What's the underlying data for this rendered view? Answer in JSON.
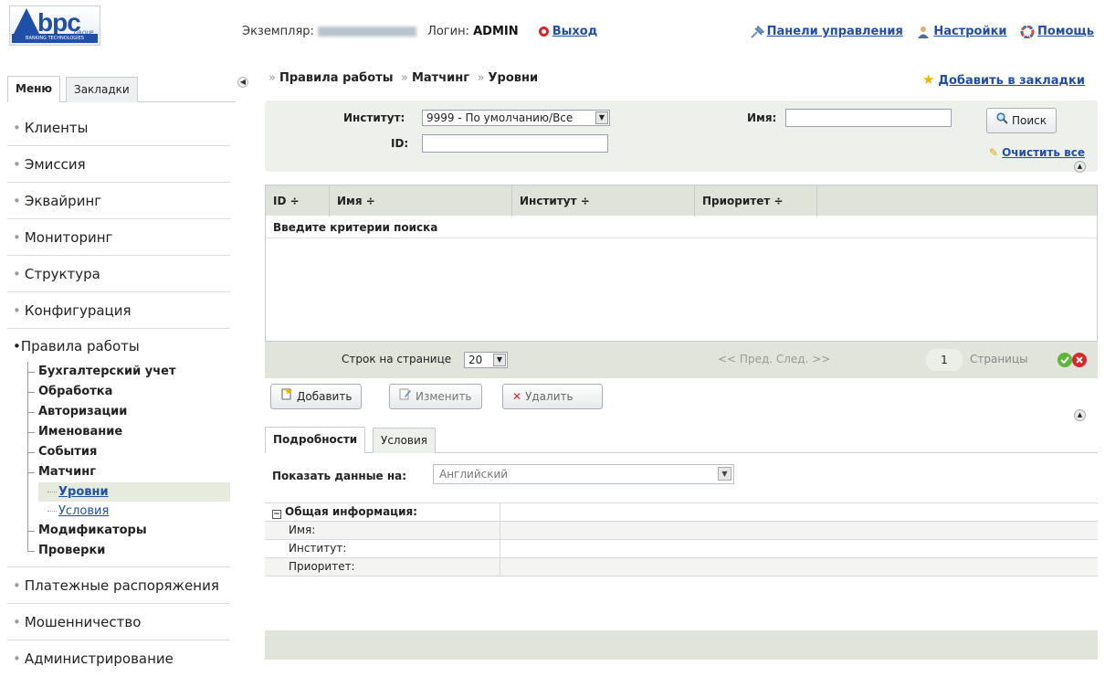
{
  "header": {
    "logo_text": "bpc",
    "logo_group": "GROUP",
    "logo_tagline": "BANKING TECHNOLOGIES",
    "instance_label": "Экземпляр:",
    "login_label": "Логин:",
    "login_value": "ADMIN",
    "logout": "Выход",
    "links": [
      "Панели управления",
      "Настройки",
      "Помощь"
    ]
  },
  "sidebar": {
    "tabs": [
      "Меню",
      "Закладки"
    ],
    "items_top": [
      "Клиенты",
      "Эмиссия",
      "Эквайринг",
      "Мониторинг",
      "Структура",
      "Конфигурация"
    ],
    "group": {
      "label": "Правила работы",
      "children": [
        "Бухгалтерский учет",
        "Обработка",
        "Авторизации",
        "Именование",
        "События",
        "Матчинг"
      ],
      "matching_children": [
        "Уровни",
        "Условия"
      ],
      "children_after": [
        "Модификаторы",
        "Проверки"
      ]
    },
    "items_bottom": [
      "Платежные распоряжения",
      "Мошенничество",
      "Администрирование"
    ]
  },
  "breadcrumb": [
    "Правила работы",
    "Матчинг",
    "Уровни"
  ],
  "bookmark": "Добавить в закладки",
  "filter": {
    "institute_label": "Институт:",
    "institute_value": "9999 - По умолчанию/Все",
    "id_label": "ID:",
    "name_label": "Имя:",
    "search_button": "Поиск",
    "clear_all": "Очистить все"
  },
  "grid": {
    "columns": [
      "ID ÷",
      "Имя ÷",
      "Институт ÷",
      "Приоритет ÷"
    ],
    "empty_message": "Введите критерии поиска"
  },
  "pager": {
    "rows_label": "Строк на странице",
    "rows_value": "20",
    "prev_next": "<< Пред. След. >>",
    "page_number": "1",
    "pages_label": "Страницы"
  },
  "toolbar": {
    "add": "Добавить",
    "edit": "Изменить",
    "delete": "Удалить"
  },
  "details": {
    "tabs": [
      "Подробности",
      "Условия"
    ],
    "show_data_label": "Показать данные на:",
    "language_value": "Английский",
    "section_title": "Общая информация:",
    "fields": [
      "Имя:",
      "Институт:",
      "Приоритет:"
    ]
  },
  "colors": {
    "link": "#1f4fa8",
    "panel_bg": "#eef0eb",
    "header_bg": "#dfe3da",
    "accent_star": "#f2b400",
    "delete_red": "#d8262b"
  }
}
